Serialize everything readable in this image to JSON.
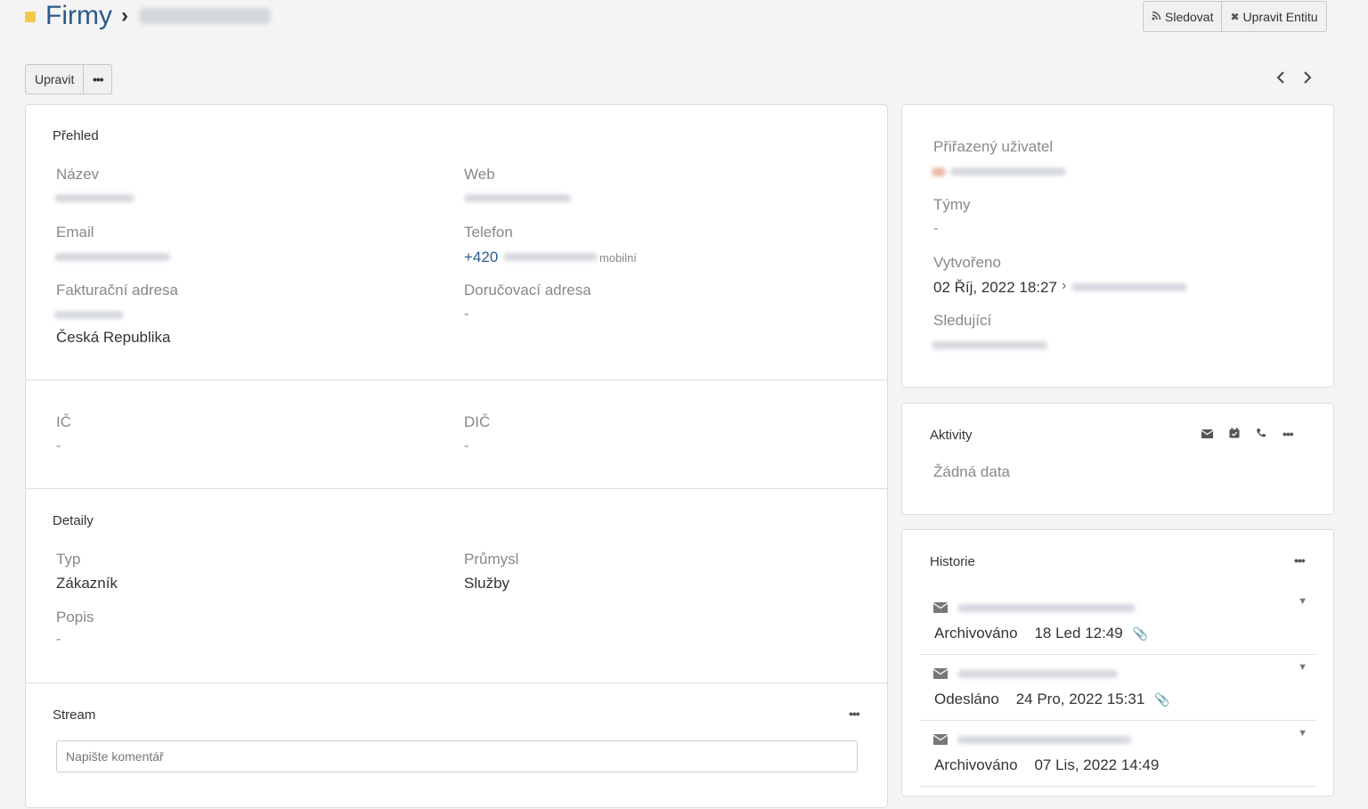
{
  "header": {
    "title": "Firmy",
    "follow_label": "Sledovat",
    "edit_entity_label": "Upravit Entitu"
  },
  "toolbar": {
    "edit_label": "Upravit",
    "more": "•••"
  },
  "overview": {
    "title": "Přehled",
    "name_label": "Název",
    "web_label": "Web",
    "email_label": "Email",
    "phone_label": "Telefon",
    "phone_prefix": "+420",
    "phone_type": "mobilní",
    "billing_label": "Fakturační adresa",
    "billing_country": "Česká Republika",
    "shipping_label": "Doručovací adresa",
    "shipping_value": "-",
    "ic_label": "IČ",
    "ic_value": "-",
    "dic_label": "DIČ",
    "dic_value": "-"
  },
  "details": {
    "title": "Detaily",
    "type_label": "Typ",
    "type_value": "Zákazník",
    "industry_label": "Průmysl",
    "industry_value": "Služby",
    "description_label": "Popis",
    "description_value": "-"
  },
  "stream": {
    "title": "Stream",
    "comment_placeholder": "Napište komentář"
  },
  "side": {
    "assigned_label": "Přiřazený uživatel",
    "teams_label": "Týmy",
    "teams_value": "-",
    "created_label": "Vytvořeno",
    "created_value": "02 Říj, 2022 18:27",
    "followers_label": "Sledující"
  },
  "activities": {
    "title": "Aktivity",
    "empty": "Žádná data"
  },
  "history": {
    "title": "Historie",
    "items": [
      {
        "status": "Archivováno",
        "date": "18 Led 12:49",
        "attachment": true
      },
      {
        "status": "Odesláno",
        "date": "24 Pro, 2022 15:31",
        "attachment": true
      },
      {
        "status": "Archivováno",
        "date": "07 Lis, 2022 14:49",
        "attachment": false
      }
    ]
  },
  "colors": {
    "title_blue": "#2a5a8b",
    "entity_mark": "#f0c94b"
  }
}
